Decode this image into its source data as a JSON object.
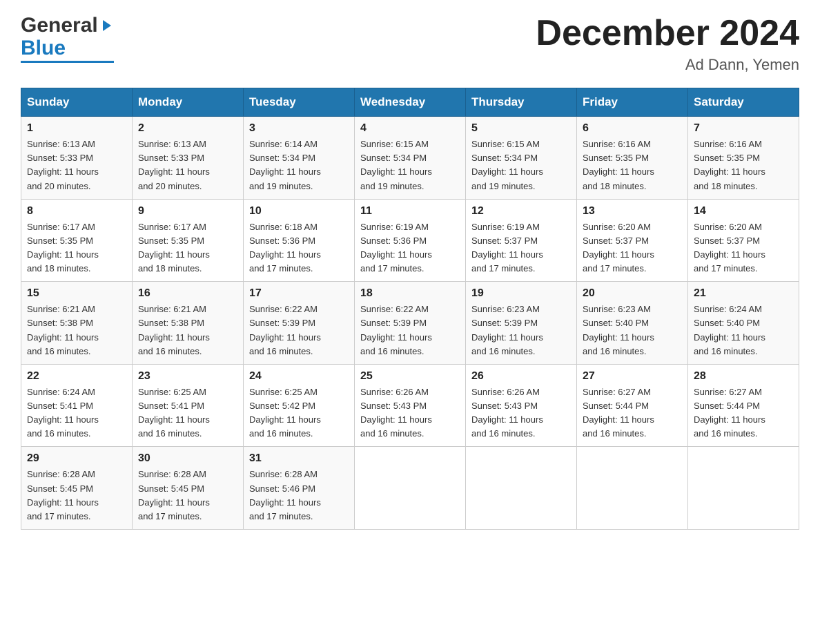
{
  "header": {
    "logo_general": "General",
    "logo_blue": "Blue",
    "title": "December 2024",
    "location": "Ad Dann, Yemen"
  },
  "days_of_week": [
    "Sunday",
    "Monday",
    "Tuesday",
    "Wednesday",
    "Thursday",
    "Friday",
    "Saturday"
  ],
  "weeks": [
    [
      {
        "day": "1",
        "sunrise": "6:13 AM",
        "sunset": "5:33 PM",
        "daylight": "11 hours and 20 minutes."
      },
      {
        "day": "2",
        "sunrise": "6:13 AM",
        "sunset": "5:33 PM",
        "daylight": "11 hours and 20 minutes."
      },
      {
        "day": "3",
        "sunrise": "6:14 AM",
        "sunset": "5:34 PM",
        "daylight": "11 hours and 19 minutes."
      },
      {
        "day": "4",
        "sunrise": "6:15 AM",
        "sunset": "5:34 PM",
        "daylight": "11 hours and 19 minutes."
      },
      {
        "day": "5",
        "sunrise": "6:15 AM",
        "sunset": "5:34 PM",
        "daylight": "11 hours and 19 minutes."
      },
      {
        "day": "6",
        "sunrise": "6:16 AM",
        "sunset": "5:35 PM",
        "daylight": "11 hours and 18 minutes."
      },
      {
        "day": "7",
        "sunrise": "6:16 AM",
        "sunset": "5:35 PM",
        "daylight": "11 hours and 18 minutes."
      }
    ],
    [
      {
        "day": "8",
        "sunrise": "6:17 AM",
        "sunset": "5:35 PM",
        "daylight": "11 hours and 18 minutes."
      },
      {
        "day": "9",
        "sunrise": "6:17 AM",
        "sunset": "5:35 PM",
        "daylight": "11 hours and 18 minutes."
      },
      {
        "day": "10",
        "sunrise": "6:18 AM",
        "sunset": "5:36 PM",
        "daylight": "11 hours and 17 minutes."
      },
      {
        "day": "11",
        "sunrise": "6:19 AM",
        "sunset": "5:36 PM",
        "daylight": "11 hours and 17 minutes."
      },
      {
        "day": "12",
        "sunrise": "6:19 AM",
        "sunset": "5:37 PM",
        "daylight": "11 hours and 17 minutes."
      },
      {
        "day": "13",
        "sunrise": "6:20 AM",
        "sunset": "5:37 PM",
        "daylight": "11 hours and 17 minutes."
      },
      {
        "day": "14",
        "sunrise": "6:20 AM",
        "sunset": "5:37 PM",
        "daylight": "11 hours and 17 minutes."
      }
    ],
    [
      {
        "day": "15",
        "sunrise": "6:21 AM",
        "sunset": "5:38 PM",
        "daylight": "11 hours and 16 minutes."
      },
      {
        "day": "16",
        "sunrise": "6:21 AM",
        "sunset": "5:38 PM",
        "daylight": "11 hours and 16 minutes."
      },
      {
        "day": "17",
        "sunrise": "6:22 AM",
        "sunset": "5:39 PM",
        "daylight": "11 hours and 16 minutes."
      },
      {
        "day": "18",
        "sunrise": "6:22 AM",
        "sunset": "5:39 PM",
        "daylight": "11 hours and 16 minutes."
      },
      {
        "day": "19",
        "sunrise": "6:23 AM",
        "sunset": "5:39 PM",
        "daylight": "11 hours and 16 minutes."
      },
      {
        "day": "20",
        "sunrise": "6:23 AM",
        "sunset": "5:40 PM",
        "daylight": "11 hours and 16 minutes."
      },
      {
        "day": "21",
        "sunrise": "6:24 AM",
        "sunset": "5:40 PM",
        "daylight": "11 hours and 16 minutes."
      }
    ],
    [
      {
        "day": "22",
        "sunrise": "6:24 AM",
        "sunset": "5:41 PM",
        "daylight": "11 hours and 16 minutes."
      },
      {
        "day": "23",
        "sunrise": "6:25 AM",
        "sunset": "5:41 PM",
        "daylight": "11 hours and 16 minutes."
      },
      {
        "day": "24",
        "sunrise": "6:25 AM",
        "sunset": "5:42 PM",
        "daylight": "11 hours and 16 minutes."
      },
      {
        "day": "25",
        "sunrise": "6:26 AM",
        "sunset": "5:43 PM",
        "daylight": "11 hours and 16 minutes."
      },
      {
        "day": "26",
        "sunrise": "6:26 AM",
        "sunset": "5:43 PM",
        "daylight": "11 hours and 16 minutes."
      },
      {
        "day": "27",
        "sunrise": "6:27 AM",
        "sunset": "5:44 PM",
        "daylight": "11 hours and 16 minutes."
      },
      {
        "day": "28",
        "sunrise": "6:27 AM",
        "sunset": "5:44 PM",
        "daylight": "11 hours and 16 minutes."
      }
    ],
    [
      {
        "day": "29",
        "sunrise": "6:28 AM",
        "sunset": "5:45 PM",
        "daylight": "11 hours and 17 minutes."
      },
      {
        "day": "30",
        "sunrise": "6:28 AM",
        "sunset": "5:45 PM",
        "daylight": "11 hours and 17 minutes."
      },
      {
        "day": "31",
        "sunrise": "6:28 AM",
        "sunset": "5:46 PM",
        "daylight": "11 hours and 17 minutes."
      },
      null,
      null,
      null,
      null
    ]
  ],
  "label_sunrise": "Sunrise:",
  "label_sunset": "Sunset:",
  "label_daylight": "Daylight:"
}
